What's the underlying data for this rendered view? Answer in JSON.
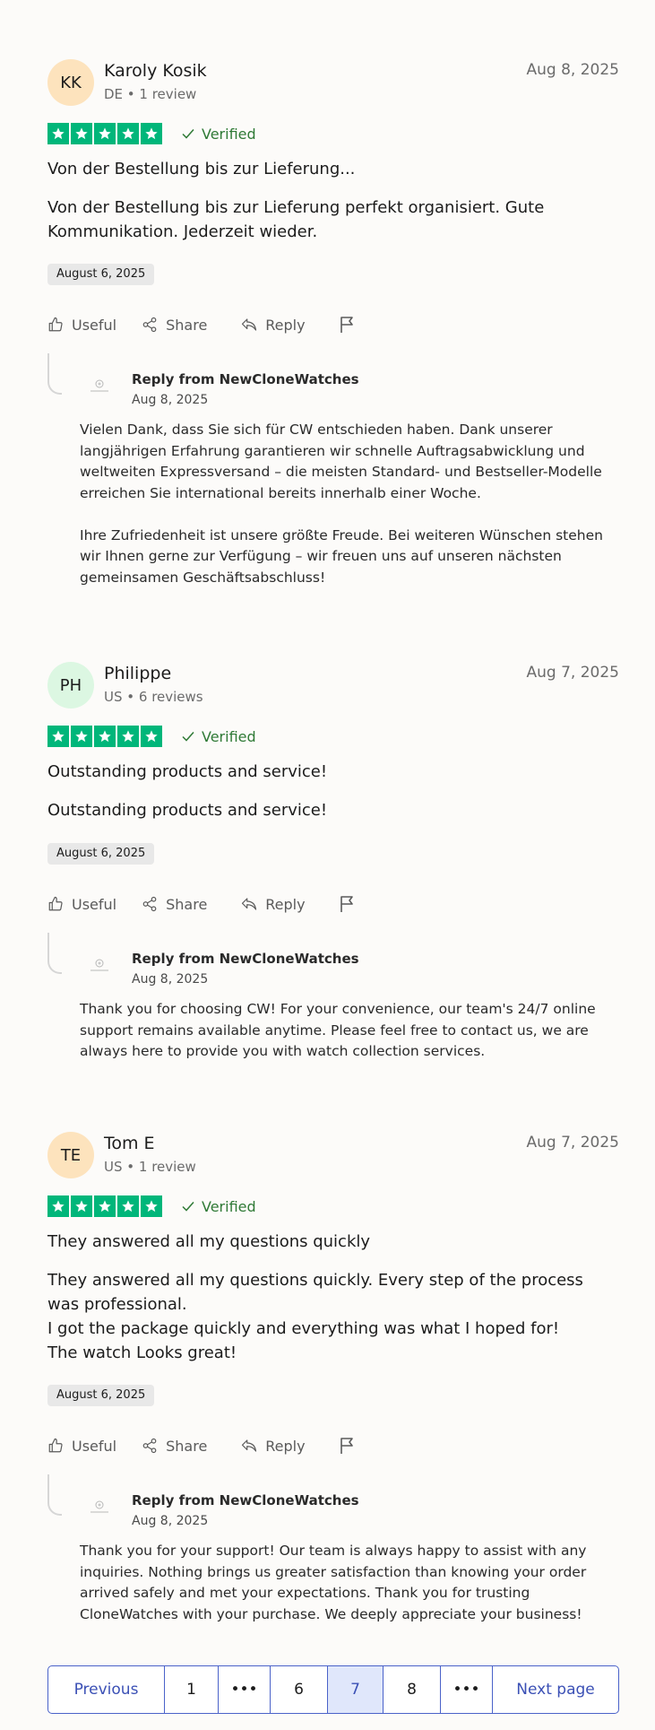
{
  "reviews": [
    {
      "initials": "KK",
      "avatar_color": "#fde3bd",
      "name": "Karoly Kosik",
      "meta": "DE • 1 review",
      "date": "Aug 8, 2025",
      "rating": 5,
      "verified_label": "Verified",
      "title": "Von der Bestellung bis zur Lieferung...",
      "body": [
        "Von der Bestellung bis zur Lieferung perfekt organisiert. Gute Kommunikation. Jederzeit wieder."
      ],
      "experience_date": "August 6, 2025",
      "actions": {
        "useful": "Useful",
        "share": "Share",
        "reply": "Reply"
      },
      "reply": {
        "from": "Reply from NewCloneWatches",
        "date": "Aug 8, 2025",
        "paragraphs": [
          "Vielen Dank, dass Sie sich für CW entschieden haben. Dank unserer langjährigen Erfahrung garantieren wir schnelle Auftragsabwicklung und weltweiten Expressversand – die meisten Standard- und Bestseller-Modelle erreichen Sie international bereits innerhalb einer Woche.",
          "Ihre Zufriedenheit ist unsere größte Freude. Bei weiteren Wünschen stehen wir Ihnen gerne zur Verfügung – wir freuen uns auf unseren nächsten gemeinsamen Geschäftsabschluss!"
        ]
      }
    },
    {
      "initials": "PH",
      "avatar_color": "#dcf7e2",
      "name": "Philippe",
      "meta": "US • 6 reviews",
      "date": "Aug 7, 2025",
      "rating": 5,
      "verified_label": "Verified",
      "title": "Outstanding products and service!",
      "body": [
        "Outstanding products and service!"
      ],
      "experience_date": "August 6, 2025",
      "actions": {
        "useful": "Useful",
        "share": "Share",
        "reply": "Reply"
      },
      "reply": {
        "from": "Reply from NewCloneWatches",
        "date": "Aug 8, 2025",
        "paragraphs": [
          "Thank you for choosing CW! For your convenience, our team's 24/7 online support remains available anytime. Please feel free to contact us, we are always here to provide you with watch collection services."
        ]
      }
    },
    {
      "initials": "TE",
      "avatar_color": "#fde3bd",
      "name": "Tom E",
      "meta": "US • 1 review",
      "date": "Aug 7, 2025",
      "rating": 5,
      "verified_label": "Verified",
      "title": "They answered all my questions quickly",
      "body": [
        "They answered all my questions quickly. Every step of the process was professional.",
        "I got the package quickly and everything was what I hoped for!",
        "The watch Looks great!"
      ],
      "experience_date": "August 6, 2025",
      "actions": {
        "useful": "Useful",
        "share": "Share",
        "reply": "Reply"
      },
      "reply": {
        "from": "Reply from NewCloneWatches",
        "date": "Aug 8, 2025",
        "paragraphs": [
          "Thank you for your support! Our team is always happy to assist with any inquiries. Nothing brings us greater satisfaction than knowing your order arrived safely and met your expectations. Thank you for trusting CloneWatches with your purchase. We deeply appreciate your business!"
        ]
      }
    }
  ],
  "pagination": {
    "previous": "Previous",
    "pages": [
      "1",
      "•••",
      "6",
      "7",
      "8",
      "•••"
    ],
    "current": "7",
    "next": "Next page"
  },
  "colors": {
    "star_green": "#00b67a",
    "verified_green": "#2f7a36",
    "link_blue": "#3b50b5",
    "current_page_bg": "#e0e7fb"
  }
}
